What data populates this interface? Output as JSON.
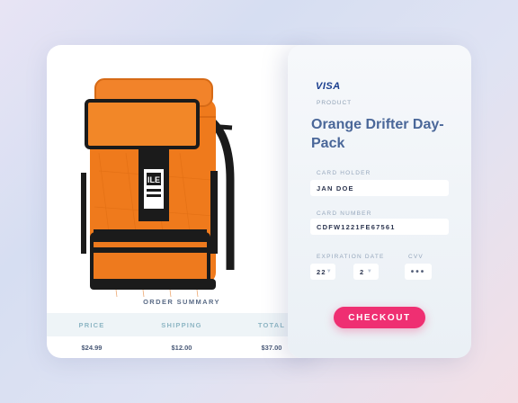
{
  "card_brand": "VISA",
  "product": {
    "label": "PRODUCT",
    "name": "Orange Drifter Day-Pack"
  },
  "card_holder": {
    "label": "CARD HOLDER",
    "value": "JAN DOE"
  },
  "card_number": {
    "label": "CARD NUMBER",
    "value": "CDFW1221FE67561"
  },
  "expiration": {
    "label": "EXPIRATION DATE",
    "day": "22",
    "month": "2"
  },
  "cvv": {
    "label": "CVV",
    "value": "•••"
  },
  "checkout_label": "CHECKOUT",
  "order_summary": {
    "title": "ORDER SUMMARY",
    "headers": [
      "PRICE",
      "SHIPPING",
      "TOTAL"
    ],
    "values": [
      "$24.99",
      "$12.00",
      "$37.00"
    ]
  },
  "image": {
    "subject": "orange roll-top backpack",
    "badge_text": "ILE"
  },
  "colors": {
    "accent": "#ef2f72",
    "title": "#4a6799",
    "bag": "#ef7a1c",
    "visa": "#1b3f8f"
  }
}
